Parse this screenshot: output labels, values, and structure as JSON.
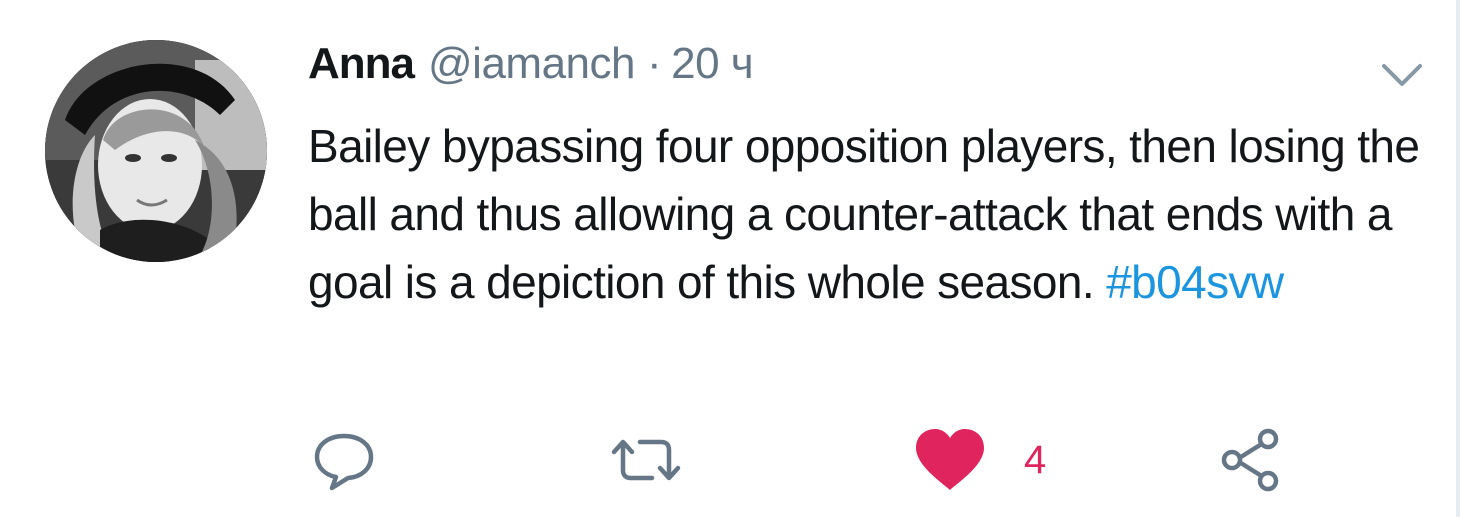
{
  "tweet": {
    "author_name": "Anna",
    "author_handle": "@iamanch",
    "separator": "·",
    "timestamp": "20 ч",
    "text": "Bailey bypassing four opposition players, then losing the ball and thus allowing a counter-attack that ends with a goal is a depiction of this whole season. ",
    "hashtag": "#b04svw",
    "like_count": "4"
  },
  "icons": {
    "reply": "reply-icon",
    "retweet": "retweet-icon",
    "like": "heart-icon",
    "share": "share-icon",
    "menu": "chevron-down-icon"
  },
  "colors": {
    "text": "#14171a",
    "secondary": "#657786",
    "link": "#1b95e0",
    "like": "#e0245e"
  }
}
